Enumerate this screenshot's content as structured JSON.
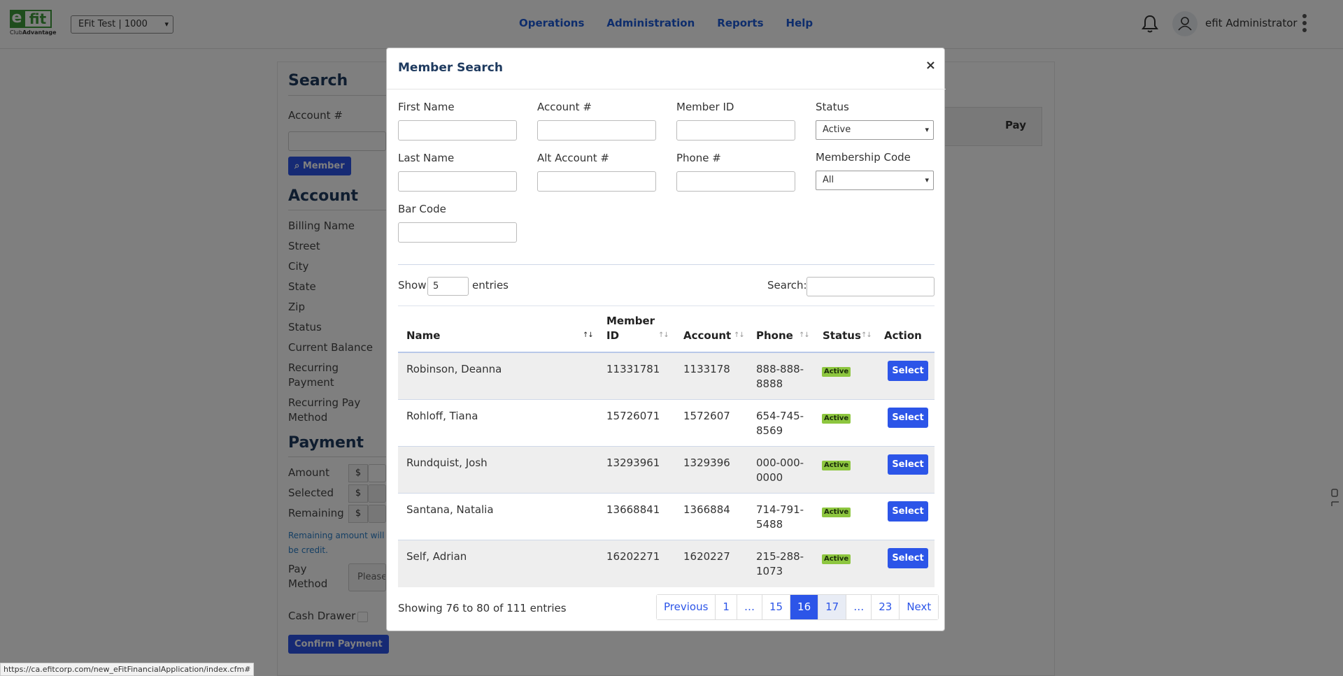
{
  "app": {
    "logo_brand": "efit",
    "logo_sub_plain": "Club",
    "logo_sub_bold": "Advantage",
    "club_selector": "EFit Test | 1000",
    "nav": [
      "Operations",
      "Administration",
      "Reports",
      "Help"
    ],
    "user_name": "efit Administrator"
  },
  "background": {
    "search_heading": "Search",
    "account_label": "Account #",
    "member_button": "Member",
    "account_heading": "Account",
    "account_fields": [
      "Billing Name",
      "Street",
      "City",
      "State",
      "Zip",
      "Status",
      "Current Balance",
      "Recurring Payment",
      "Recurring Pay Method"
    ],
    "payment_heading": "Payment",
    "payment_fields": [
      "Amount",
      "Selected",
      "Remaining"
    ],
    "dollar_sign": "$",
    "remaining_note": "Remaining amount will be credit.",
    "pay_method_label": "Pay Method",
    "pay_method_placeholder": "Please",
    "cash_drawer_label": "Cash Drawer",
    "confirm_button": "Confirm Payment",
    "pay_column_header": "Pay"
  },
  "status_bar_url": "https://ca.efitcorp.com/new_eFitFinancialApplication/index.cfm#",
  "modal": {
    "title": "Member Search",
    "close": "×",
    "labels": {
      "first_name": "First Name",
      "account": "Account #",
      "member_id": "Member ID",
      "status": "Status",
      "last_name": "Last Name",
      "alt_account": "Alt Account #",
      "phone": "Phone #",
      "membership_code": "Membership Code",
      "bar_code": "Bar Code"
    },
    "status_value": "Active",
    "membership_code_value": "All",
    "show_label": "Show",
    "page_length": "5",
    "entries_label": "entries",
    "search_label": "Search:",
    "columns": {
      "name": "Name",
      "member_id_line1": "Member",
      "member_id_line2": "ID",
      "account": "Account",
      "phone": "Phone",
      "status": "Status",
      "action": "Action"
    },
    "rows": [
      {
        "name": "Robinson, Deanna",
        "member_id": "11331781",
        "account": "1133178",
        "phone_1": "888-888-",
        "phone_2": "8888",
        "status": "Active",
        "action": "Select"
      },
      {
        "name": "Rohloff, Tiana",
        "member_id": "15726071",
        "account": "1572607",
        "phone_1": "654-745-",
        "phone_2": "8569",
        "status": "Active",
        "action": "Select"
      },
      {
        "name": "Rundquist, Josh",
        "member_id": "13293961",
        "account": "1329396",
        "phone_1": "000-000-",
        "phone_2": "0000",
        "status": "Active",
        "action": "Select"
      },
      {
        "name": "Santana, Natalia",
        "member_id": "13668841",
        "account": "1366884",
        "phone_1": "714-791-",
        "phone_2": "5488",
        "status": "Active",
        "action": "Select"
      },
      {
        "name": "Self, Adrian",
        "member_id": "16202271",
        "account": "1620227",
        "phone_1": "215-288-",
        "phone_2": "1073",
        "status": "Active",
        "action": "Select"
      }
    ],
    "info": "Showing 76 to 80 of 111 entries",
    "pagination": [
      "Previous",
      "1",
      "…",
      "15",
      "16",
      "17",
      "…",
      "23",
      "Next"
    ],
    "current_page": "16"
  }
}
